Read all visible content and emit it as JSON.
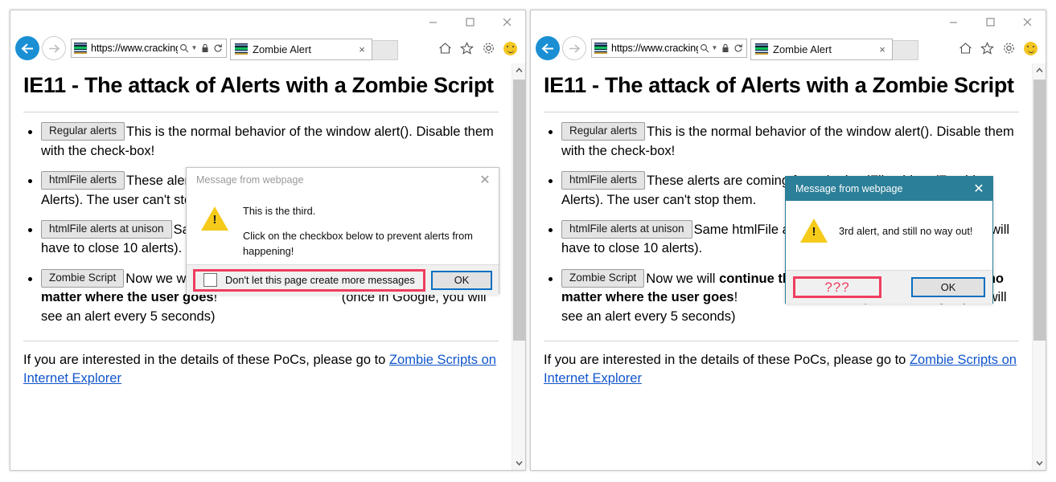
{
  "window_controls": {
    "minimize": "minimize-icon",
    "maximize": "maximize-icon",
    "close": "close-icon"
  },
  "browser": {
    "url": "https://www.cracking....",
    "url_protocol": "https://",
    "url_rest": "www.cracking....",
    "tab_title": "Zombie Alert",
    "tab_close": "×",
    "address_icons": [
      "search-icon",
      "dropdown-caret",
      "lock-icon",
      "refresh-icon"
    ],
    "command_icons": [
      "home-icon",
      "favorites-star-icon",
      "settings-gear-icon",
      "smiley-feedback-icon"
    ]
  },
  "page": {
    "title": "IE11 - The attack of Alerts with a Zombie Script",
    "bullets": [
      {
        "button": "Regular alerts",
        "text": "This is the normal behavior of the window alert(). Disable them with the check-box!"
      },
      {
        "button": "htmlFile alerts",
        "text": "These alerts are coming from the htmlFile object (Zombie Alerts). The user can't stop them."
      },
      {
        "button": "htmlFile alerts at unison",
        "text": "Same htmlFile alerts, but this time all at once (you will have to close 10 alerts)."
      },
      {
        "button": "Zombie Script",
        "text_plain_1": "Now we will ",
        "text_bold": "continue throwing alerts every 5 seconds, no matter where the user goes",
        "text_plain_2": "!",
        "note": "(once in Google, you will see an alert every 5 seconds)"
      }
    ],
    "closing_text": "If you are interested in the details of these PoCs, please go to ",
    "closing_link": "Zombie Scripts on Internet Explorer"
  },
  "dialog_left": {
    "state": "inactive",
    "title": "Message from webpage",
    "close": "✕",
    "icon": "warning-triangle-icon",
    "message_line_1": "This is the third.",
    "message_line_2": "Click on the checkbox below to prevent alerts from happening!",
    "checkbox_label": "Don't let this page create more messages",
    "checkbox_checked": false,
    "ok_label": "OK",
    "highlight_color": "#ef3d5e",
    "ok_border_color": "#0a6fc2"
  },
  "dialog_right": {
    "state": "active",
    "title": "Message from webpage",
    "close": "✕",
    "icon": "warning-triangle-icon",
    "message": "3rd alert, and still no way out!",
    "missing_checkbox_marker": "???",
    "ok_label": "OK",
    "titlebar_color": "#2b7f98",
    "highlight_color": "#ef3d5e",
    "ok_border_color": "#0a6fc2"
  }
}
